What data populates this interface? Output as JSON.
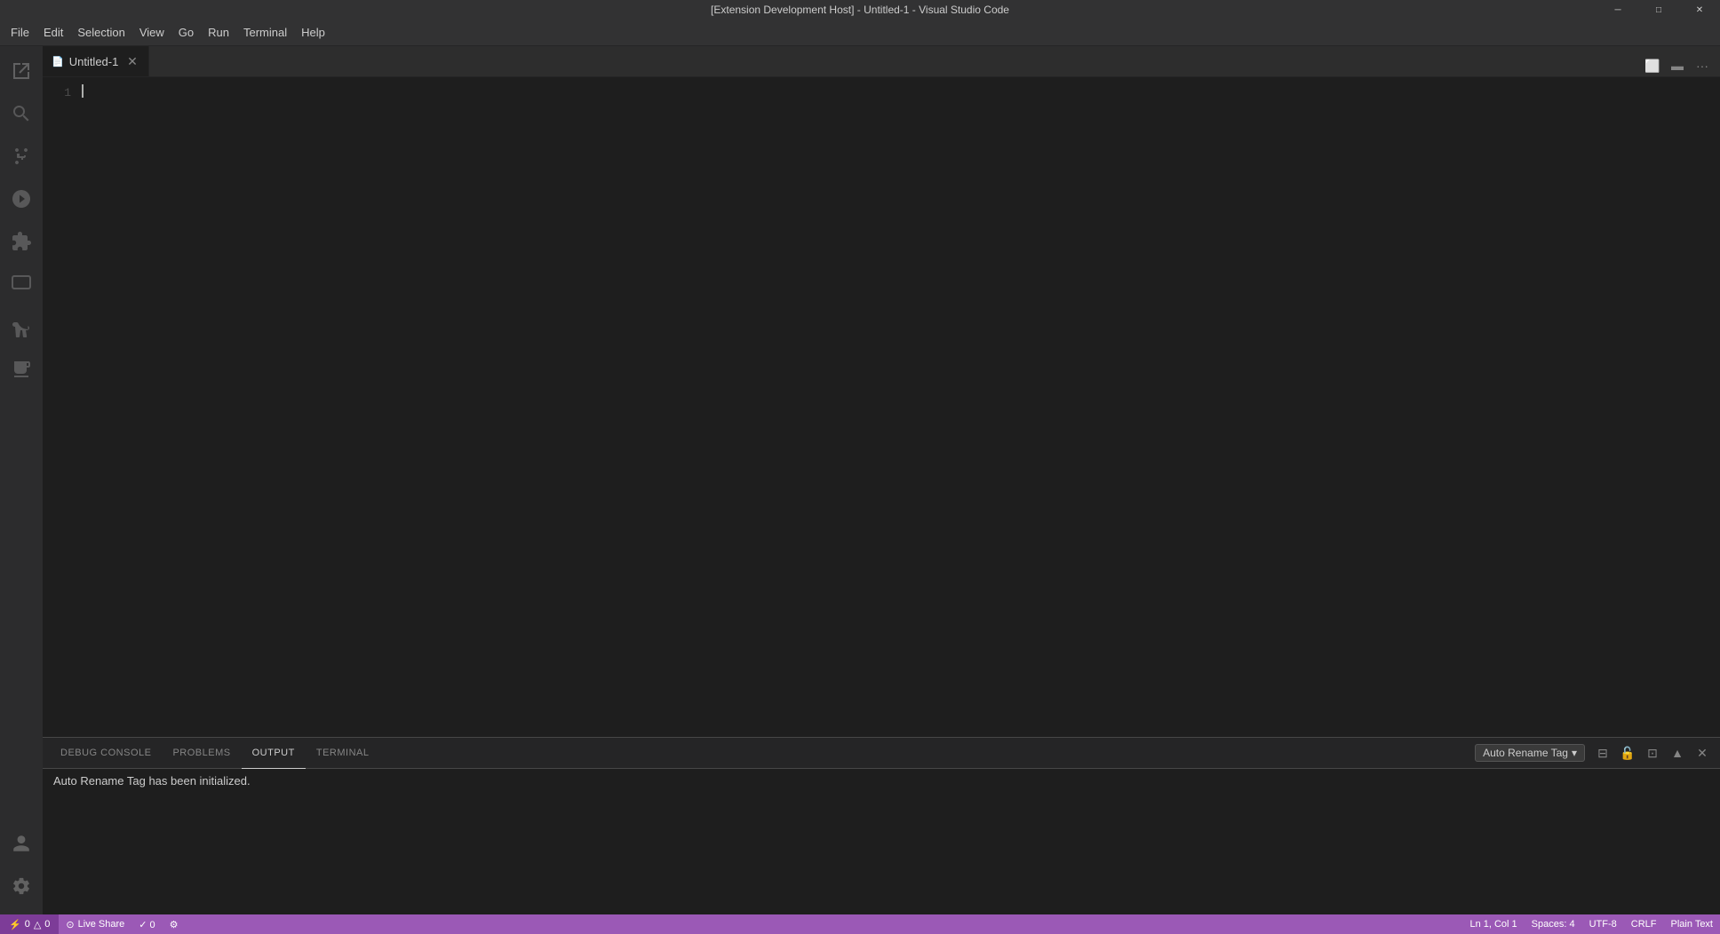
{
  "window": {
    "title": "[Extension Development Host] - Untitled-1 - Visual Studio Code",
    "controls": {
      "minimize": "─",
      "maximize": "□",
      "close": "✕"
    }
  },
  "menu": {
    "items": [
      "File",
      "Edit",
      "Selection",
      "View",
      "Go",
      "Run",
      "Terminal",
      "Help"
    ]
  },
  "activity_bar": {
    "icons": [
      {
        "name": "explorer-icon",
        "symbol": "⎘",
        "active": false
      },
      {
        "name": "search-icon",
        "symbol": "🔍",
        "active": false
      },
      {
        "name": "source-control-icon",
        "symbol": "⑂",
        "active": false
      },
      {
        "name": "run-debug-icon",
        "symbol": "▷",
        "active": false
      },
      {
        "name": "extensions-icon",
        "symbol": "⊞",
        "active": false
      },
      {
        "name": "remote-explorer-icon",
        "symbol": "⊡",
        "active": false
      },
      {
        "name": "testing-icon",
        "symbol": "⚗",
        "active": false
      },
      {
        "name": "dev-tools-icon",
        "symbol": "⊟",
        "active": false
      }
    ],
    "bottom": [
      {
        "name": "accounts-icon",
        "symbol": "◯"
      },
      {
        "name": "settings-icon",
        "symbol": "⚙"
      },
      {
        "name": "error-icon",
        "symbol": "✕"
      }
    ]
  },
  "tabs": [
    {
      "label": "Untitled-1",
      "icon": "📄",
      "active": true,
      "modified": false
    }
  ],
  "editor": {
    "line_number": "1",
    "content": ""
  },
  "panel": {
    "tabs": [
      {
        "label": "DEBUG CONSOLE",
        "active": false
      },
      {
        "label": "PROBLEMS",
        "active": false
      },
      {
        "label": "OUTPUT",
        "active": true
      },
      {
        "label": "TERMINAL",
        "active": false
      }
    ],
    "output_dropdown": "Auto Rename Tag",
    "output_text": "Auto Rename Tag has been initialized.",
    "actions": [
      {
        "name": "panel-split-icon",
        "symbol": "⊟"
      },
      {
        "name": "panel-lock-icon",
        "symbol": "🔒"
      },
      {
        "name": "panel-copy-icon",
        "symbol": "⊡"
      },
      {
        "name": "panel-maximize-icon",
        "symbol": "▲"
      },
      {
        "name": "panel-close-icon",
        "symbol": "✕"
      }
    ]
  },
  "status_bar": {
    "remote_label": "⚡ 0  △ 0",
    "live_share": "Live Share",
    "errors": "✓ 0",
    "config_icon": "⚙",
    "position": "Ln 1, Col 1",
    "spaces": "Spaces: 4",
    "encoding": "UTF-8",
    "line_ending": "CRLF",
    "language": "Plain Text"
  }
}
